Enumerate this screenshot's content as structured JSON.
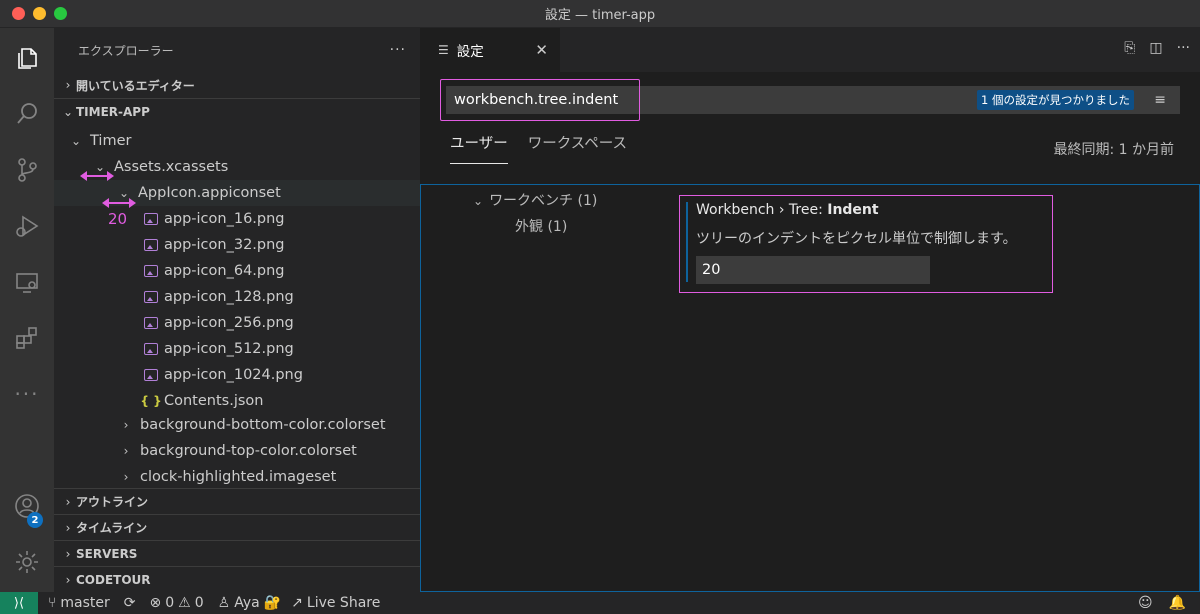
{
  "window": {
    "title": "設定 — timer-app"
  },
  "activity_bar": {
    "icons": [
      "files-icon",
      "search-icon",
      "source-control-icon",
      "run-debug-icon",
      "remote-explorer-icon",
      "extensions-icon",
      "more-icon",
      "account-icon",
      "settings-gear-icon"
    ],
    "account_badge": "2"
  },
  "sidebar": {
    "header": "エクスプローラー",
    "more": "···",
    "open_editors": "開いているエディター",
    "project": "TIMER-APP",
    "tree": [
      {
        "label": "Timer",
        "kind": "folder"
      },
      {
        "label": "Assets.xcassets",
        "kind": "folder"
      },
      {
        "label": "AppIcon.appiconset",
        "kind": "folder"
      },
      {
        "label": "app-icon_16.png",
        "kind": "image"
      },
      {
        "label": "app-icon_32.png",
        "kind": "image"
      },
      {
        "label": "app-icon_64.png",
        "kind": "image"
      },
      {
        "label": "app-icon_128.png",
        "kind": "image"
      },
      {
        "label": "app-icon_256.png",
        "kind": "image"
      },
      {
        "label": "app-icon_512.png",
        "kind": "image"
      },
      {
        "label": "app-icon_1024.png",
        "kind": "image"
      },
      {
        "label": "Contents.json",
        "kind": "json"
      },
      {
        "label": "background-bottom-color.colorset",
        "kind": "folder-collapsed"
      },
      {
        "label": "background-top-color.colorset",
        "kind": "folder-collapsed"
      },
      {
        "label": "clock-highlighted.imageset",
        "kind": "folder-collapsed"
      }
    ],
    "outline": "アウトライン",
    "timeline": "タイムライン",
    "servers": "SERVERS",
    "codetour": "CODETOUR",
    "annotation_value": "20"
  },
  "editor": {
    "tab_label": "設定",
    "search_value": "workbench.tree.indent",
    "found_text": "1 個の設定が見つかりました",
    "scope_user": "ユーザー",
    "scope_workspace": "ワークスペース",
    "last_sync": "最終同期: 1 か月前",
    "toc_workbench": "ワークベンチ (1)",
    "toc_appearance": "外観 (1)",
    "setting_prefix": "Workbench › Tree: ",
    "setting_name": "Indent",
    "setting_desc": "ツリーのインデントをピクセル単位で制御します。",
    "setting_value": "20"
  },
  "statusbar": {
    "branch": "master",
    "errors": "0",
    "warnings": "0",
    "user": "Aya",
    "live_share": "Live Share"
  },
  "colors": {
    "annotation": "#e05ce0",
    "accent": "#0e639c",
    "remote": "#16825d"
  }
}
